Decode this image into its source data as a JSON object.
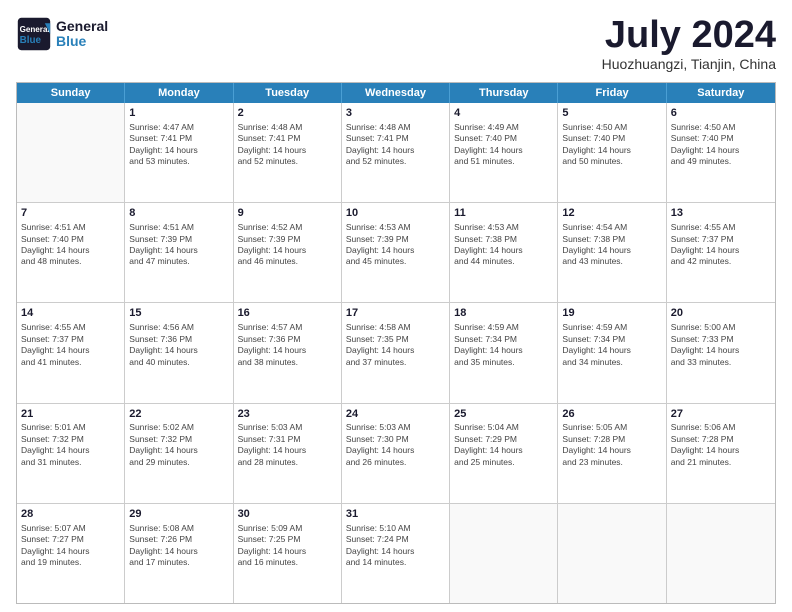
{
  "logo": {
    "line1": "General",
    "line2": "Blue"
  },
  "title": "July 2024",
  "location": "Huozhuangzi, Tianjin, China",
  "weekdays": [
    "Sunday",
    "Monday",
    "Tuesday",
    "Wednesday",
    "Thursday",
    "Friday",
    "Saturday"
  ],
  "rows": [
    [
      {
        "day": "",
        "info": ""
      },
      {
        "day": "1",
        "info": "Sunrise: 4:47 AM\nSunset: 7:41 PM\nDaylight: 14 hours\nand 53 minutes."
      },
      {
        "day": "2",
        "info": "Sunrise: 4:48 AM\nSunset: 7:41 PM\nDaylight: 14 hours\nand 52 minutes."
      },
      {
        "day": "3",
        "info": "Sunrise: 4:48 AM\nSunset: 7:41 PM\nDaylight: 14 hours\nand 52 minutes."
      },
      {
        "day": "4",
        "info": "Sunrise: 4:49 AM\nSunset: 7:40 PM\nDaylight: 14 hours\nand 51 minutes."
      },
      {
        "day": "5",
        "info": "Sunrise: 4:50 AM\nSunset: 7:40 PM\nDaylight: 14 hours\nand 50 minutes."
      },
      {
        "day": "6",
        "info": "Sunrise: 4:50 AM\nSunset: 7:40 PM\nDaylight: 14 hours\nand 49 minutes."
      }
    ],
    [
      {
        "day": "7",
        "info": "Sunrise: 4:51 AM\nSunset: 7:40 PM\nDaylight: 14 hours\nand 48 minutes."
      },
      {
        "day": "8",
        "info": "Sunrise: 4:51 AM\nSunset: 7:39 PM\nDaylight: 14 hours\nand 47 minutes."
      },
      {
        "day": "9",
        "info": "Sunrise: 4:52 AM\nSunset: 7:39 PM\nDaylight: 14 hours\nand 46 minutes."
      },
      {
        "day": "10",
        "info": "Sunrise: 4:53 AM\nSunset: 7:39 PM\nDaylight: 14 hours\nand 45 minutes."
      },
      {
        "day": "11",
        "info": "Sunrise: 4:53 AM\nSunset: 7:38 PM\nDaylight: 14 hours\nand 44 minutes."
      },
      {
        "day": "12",
        "info": "Sunrise: 4:54 AM\nSunset: 7:38 PM\nDaylight: 14 hours\nand 43 minutes."
      },
      {
        "day": "13",
        "info": "Sunrise: 4:55 AM\nSunset: 7:37 PM\nDaylight: 14 hours\nand 42 minutes."
      }
    ],
    [
      {
        "day": "14",
        "info": "Sunrise: 4:55 AM\nSunset: 7:37 PM\nDaylight: 14 hours\nand 41 minutes."
      },
      {
        "day": "15",
        "info": "Sunrise: 4:56 AM\nSunset: 7:36 PM\nDaylight: 14 hours\nand 40 minutes."
      },
      {
        "day": "16",
        "info": "Sunrise: 4:57 AM\nSunset: 7:36 PM\nDaylight: 14 hours\nand 38 minutes."
      },
      {
        "day": "17",
        "info": "Sunrise: 4:58 AM\nSunset: 7:35 PM\nDaylight: 14 hours\nand 37 minutes."
      },
      {
        "day": "18",
        "info": "Sunrise: 4:59 AM\nSunset: 7:34 PM\nDaylight: 14 hours\nand 35 minutes."
      },
      {
        "day": "19",
        "info": "Sunrise: 4:59 AM\nSunset: 7:34 PM\nDaylight: 14 hours\nand 34 minutes."
      },
      {
        "day": "20",
        "info": "Sunrise: 5:00 AM\nSunset: 7:33 PM\nDaylight: 14 hours\nand 33 minutes."
      }
    ],
    [
      {
        "day": "21",
        "info": "Sunrise: 5:01 AM\nSunset: 7:32 PM\nDaylight: 14 hours\nand 31 minutes."
      },
      {
        "day": "22",
        "info": "Sunrise: 5:02 AM\nSunset: 7:32 PM\nDaylight: 14 hours\nand 29 minutes."
      },
      {
        "day": "23",
        "info": "Sunrise: 5:03 AM\nSunset: 7:31 PM\nDaylight: 14 hours\nand 28 minutes."
      },
      {
        "day": "24",
        "info": "Sunrise: 5:03 AM\nSunset: 7:30 PM\nDaylight: 14 hours\nand 26 minutes."
      },
      {
        "day": "25",
        "info": "Sunrise: 5:04 AM\nSunset: 7:29 PM\nDaylight: 14 hours\nand 25 minutes."
      },
      {
        "day": "26",
        "info": "Sunrise: 5:05 AM\nSunset: 7:28 PM\nDaylight: 14 hours\nand 23 minutes."
      },
      {
        "day": "27",
        "info": "Sunrise: 5:06 AM\nSunset: 7:28 PM\nDaylight: 14 hours\nand 21 minutes."
      }
    ],
    [
      {
        "day": "28",
        "info": "Sunrise: 5:07 AM\nSunset: 7:27 PM\nDaylight: 14 hours\nand 19 minutes."
      },
      {
        "day": "29",
        "info": "Sunrise: 5:08 AM\nSunset: 7:26 PM\nDaylight: 14 hours\nand 17 minutes."
      },
      {
        "day": "30",
        "info": "Sunrise: 5:09 AM\nSunset: 7:25 PM\nDaylight: 14 hours\nand 16 minutes."
      },
      {
        "day": "31",
        "info": "Sunrise: 5:10 AM\nSunset: 7:24 PM\nDaylight: 14 hours\nand 14 minutes."
      },
      {
        "day": "",
        "info": ""
      },
      {
        "day": "",
        "info": ""
      },
      {
        "day": "",
        "info": ""
      }
    ]
  ]
}
